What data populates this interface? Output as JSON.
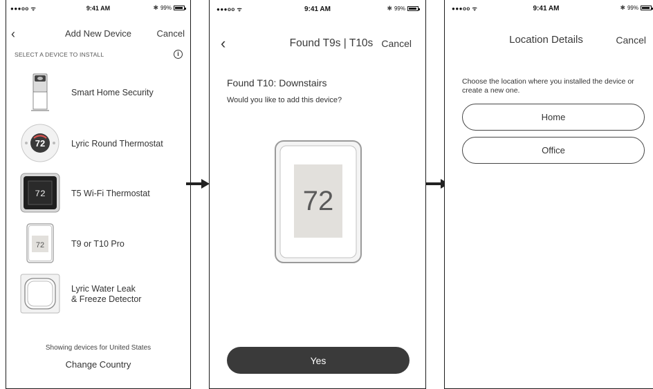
{
  "status_bar": {
    "signal": "●●●oo ᯤ",
    "time": "9:41 AM",
    "battery": "99%"
  },
  "screen1": {
    "title": "Add New Device",
    "cancel": "Cancel",
    "section_label": "SELECT A DEVICE TO INSTALL",
    "info_glyph": "i",
    "devices": [
      {
        "label": "Smart Home Security"
      },
      {
        "label": "Lyric Round Thermostat",
        "thumb_text": "72"
      },
      {
        "label": "T5 Wi-Fi Thermostat",
        "thumb_text": "72"
      },
      {
        "label": "T9 or T10 Pro",
        "thumb_text": "72"
      },
      {
        "label": "Lyric Water Leak",
        "label2": "& Freeze Detector"
      }
    ],
    "footer": "Showing devices for United States",
    "change_country": "Change Country"
  },
  "screen2": {
    "title": "Found T9s | T10s",
    "cancel": "Cancel",
    "found_title": "Found T10: Downstairs",
    "found_sub": "Would you like to add this device?",
    "display_temp": "72",
    "yes": "Yes"
  },
  "screen3": {
    "title": "Location Details",
    "cancel": "Cancel",
    "instruction": "Choose the location where you installed the device or create a new one.",
    "locations": [
      "Home",
      "Office"
    ]
  },
  "colors": {
    "button_dark": "#3a3a3a",
    "text": "#333333",
    "device_screen": "#e2e0dc"
  }
}
